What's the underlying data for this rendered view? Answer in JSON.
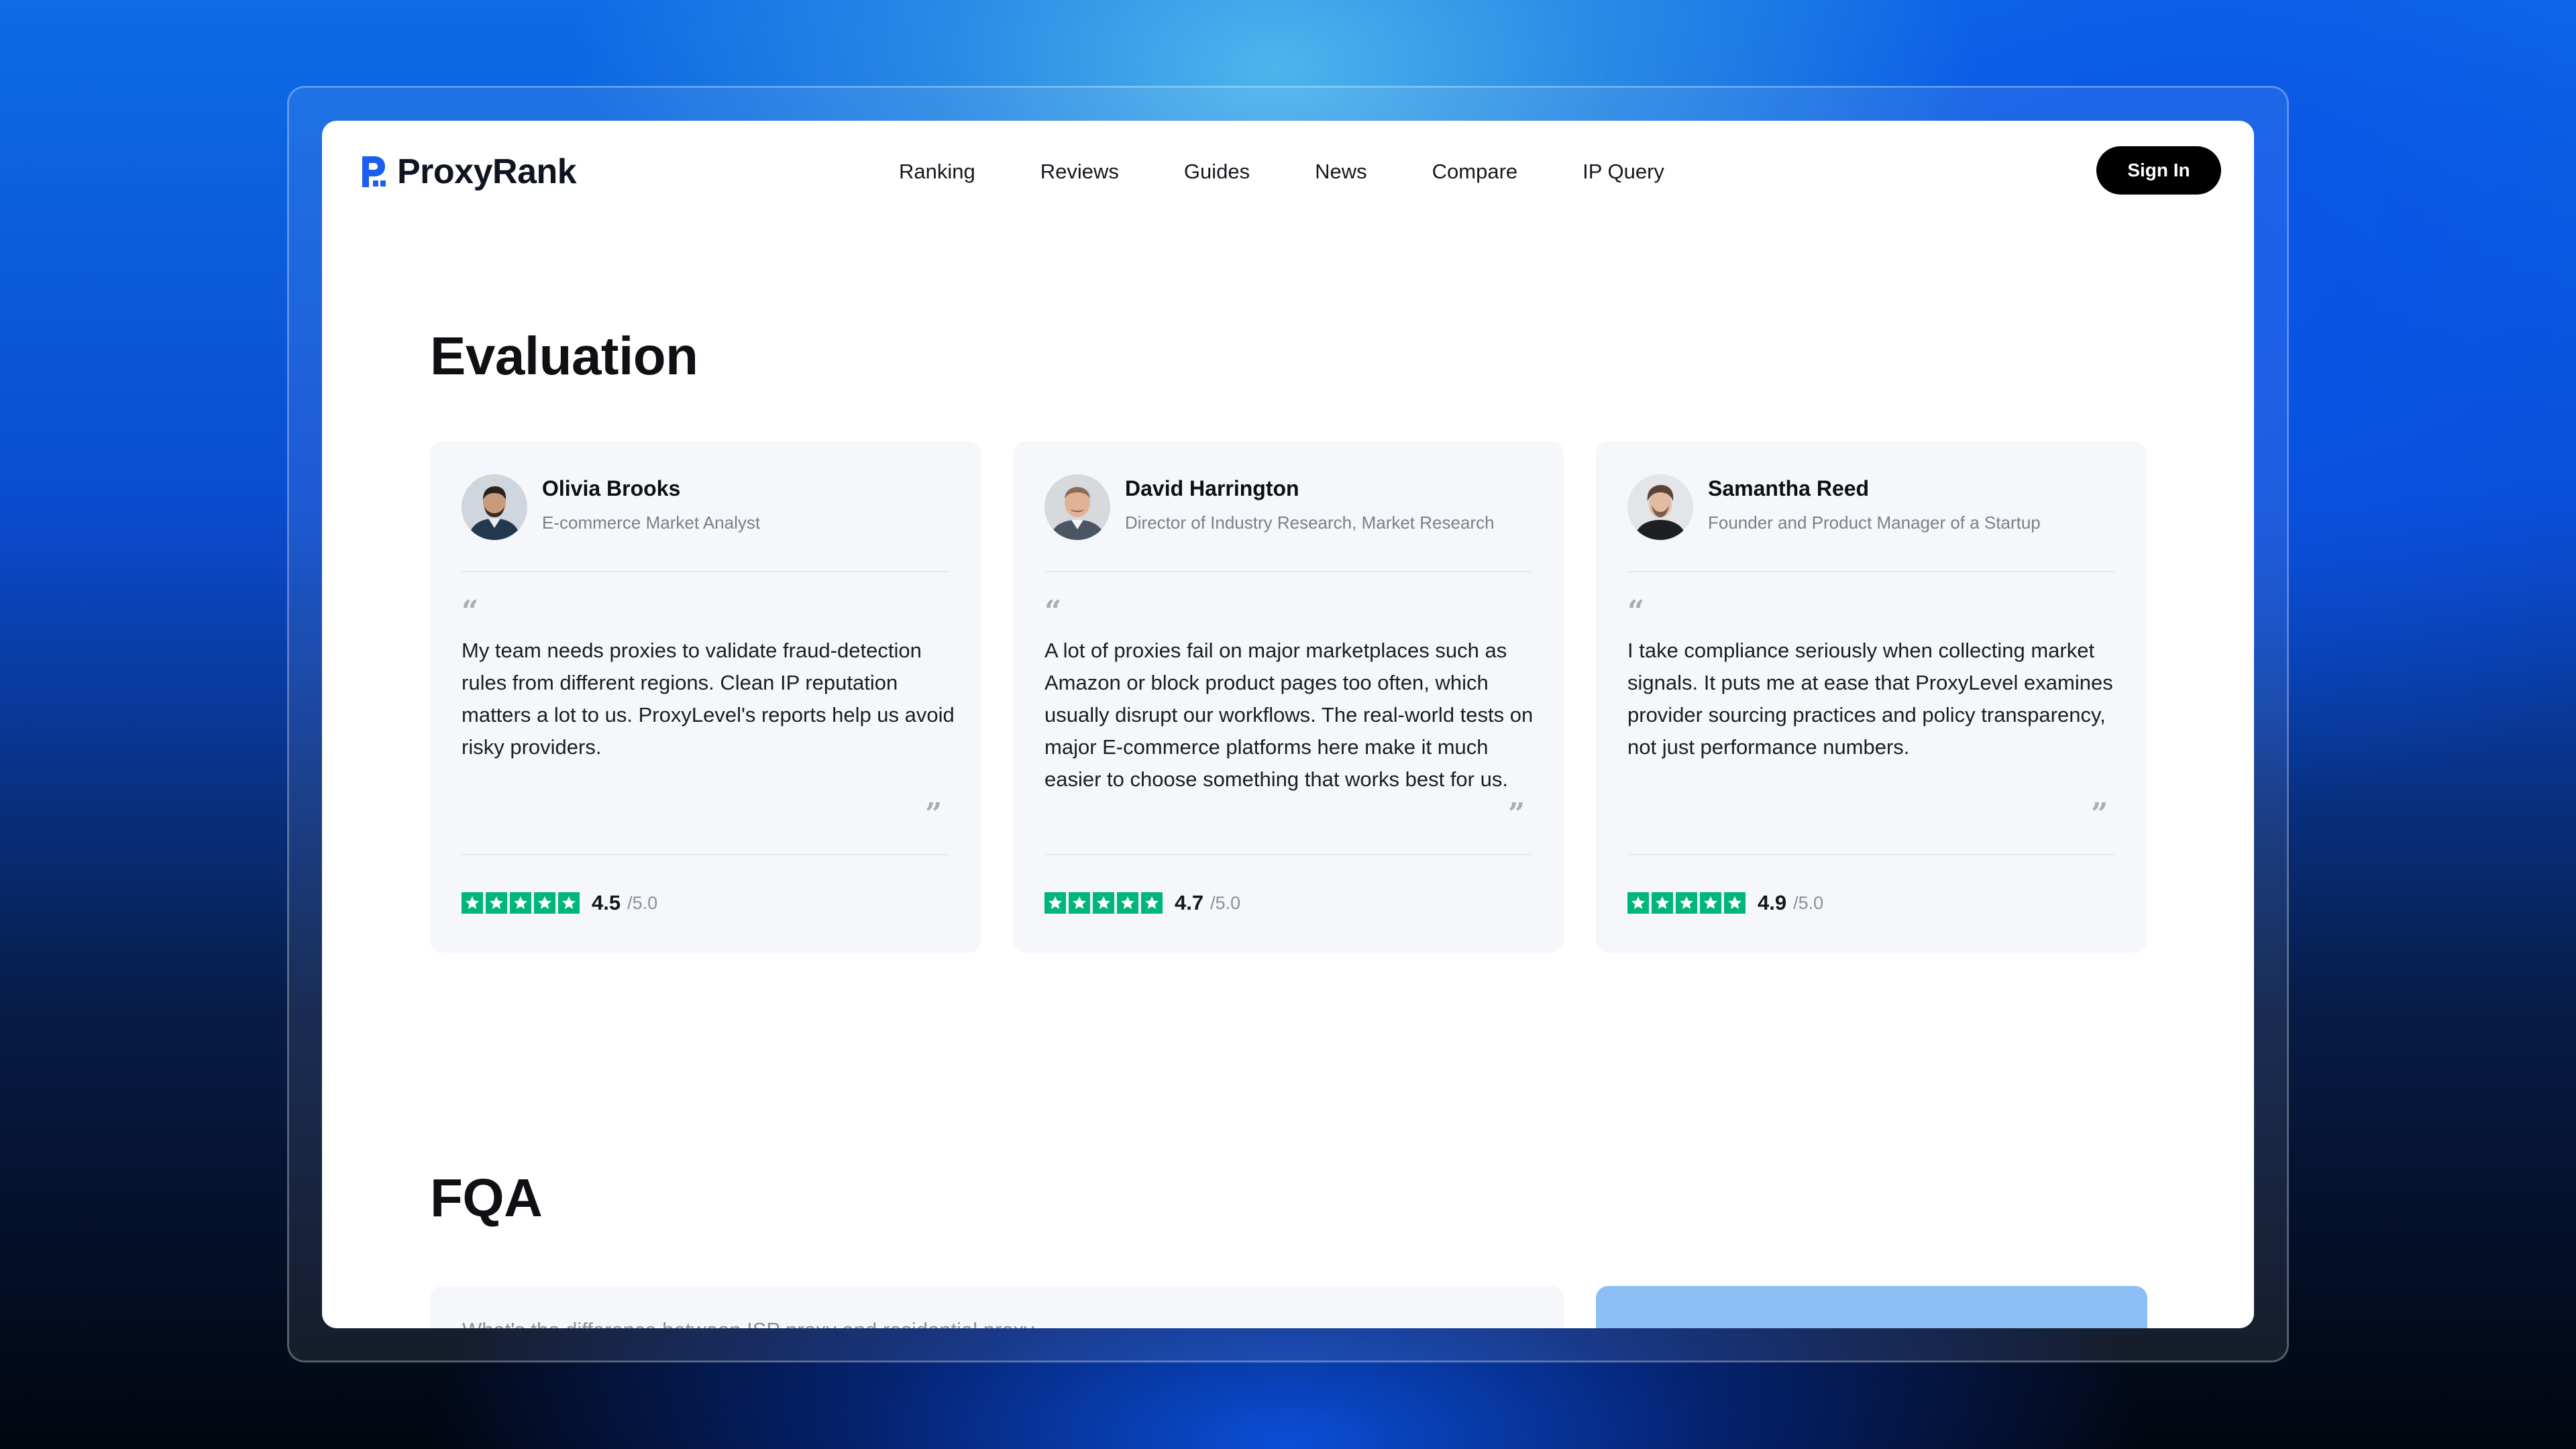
{
  "brand": {
    "name": "ProxyRank",
    "accent": "#1a5ff0"
  },
  "nav": {
    "items": [
      "Ranking",
      "Reviews",
      "Guides",
      "News",
      "Compare",
      "IP Query"
    ],
    "signin_label": "Sign In"
  },
  "evaluation": {
    "title": "Evaluation",
    "cards": [
      {
        "name": "Olivia Brooks",
        "role": "E-commerce Market Analyst",
        "quote": "My team needs proxies to validate fraud-detection rules from different regions. Clean IP reputation matters a lot to us. ProxyLevel's reports help us avoid risky providers.",
        "score": "4.5",
        "out_of": "/5.0",
        "stars": 5
      },
      {
        "name": "David Harrington",
        "role": "Director of Industry Research, Market Research",
        "quote": "A lot of proxies fail on major marketplaces such as Amazon or block product pages too often, which usually disrupt our workflows. The real-world tests on major E-commerce platforms here make it much easier to choose something that works best for us.",
        "score": "4.7",
        "out_of": "/5.0",
        "stars": 5
      },
      {
        "name": "Samantha Reed",
        "role": "Founder and Product Manager of a Startup",
        "quote": "I take compliance seriously when collecting market signals. It puts me at ease that ProxyLevel examines provider sourcing practices and policy transparency, not just performance numbers.",
        "score": "4.9",
        "out_of": "/5.0",
        "stars": 5
      }
    ],
    "quote_open": "“",
    "quote_close": "”",
    "star_color": "#00b67a"
  },
  "faq": {
    "title": "FQA",
    "first_question": "What's the difference between ISP proxy and residential proxy"
  }
}
